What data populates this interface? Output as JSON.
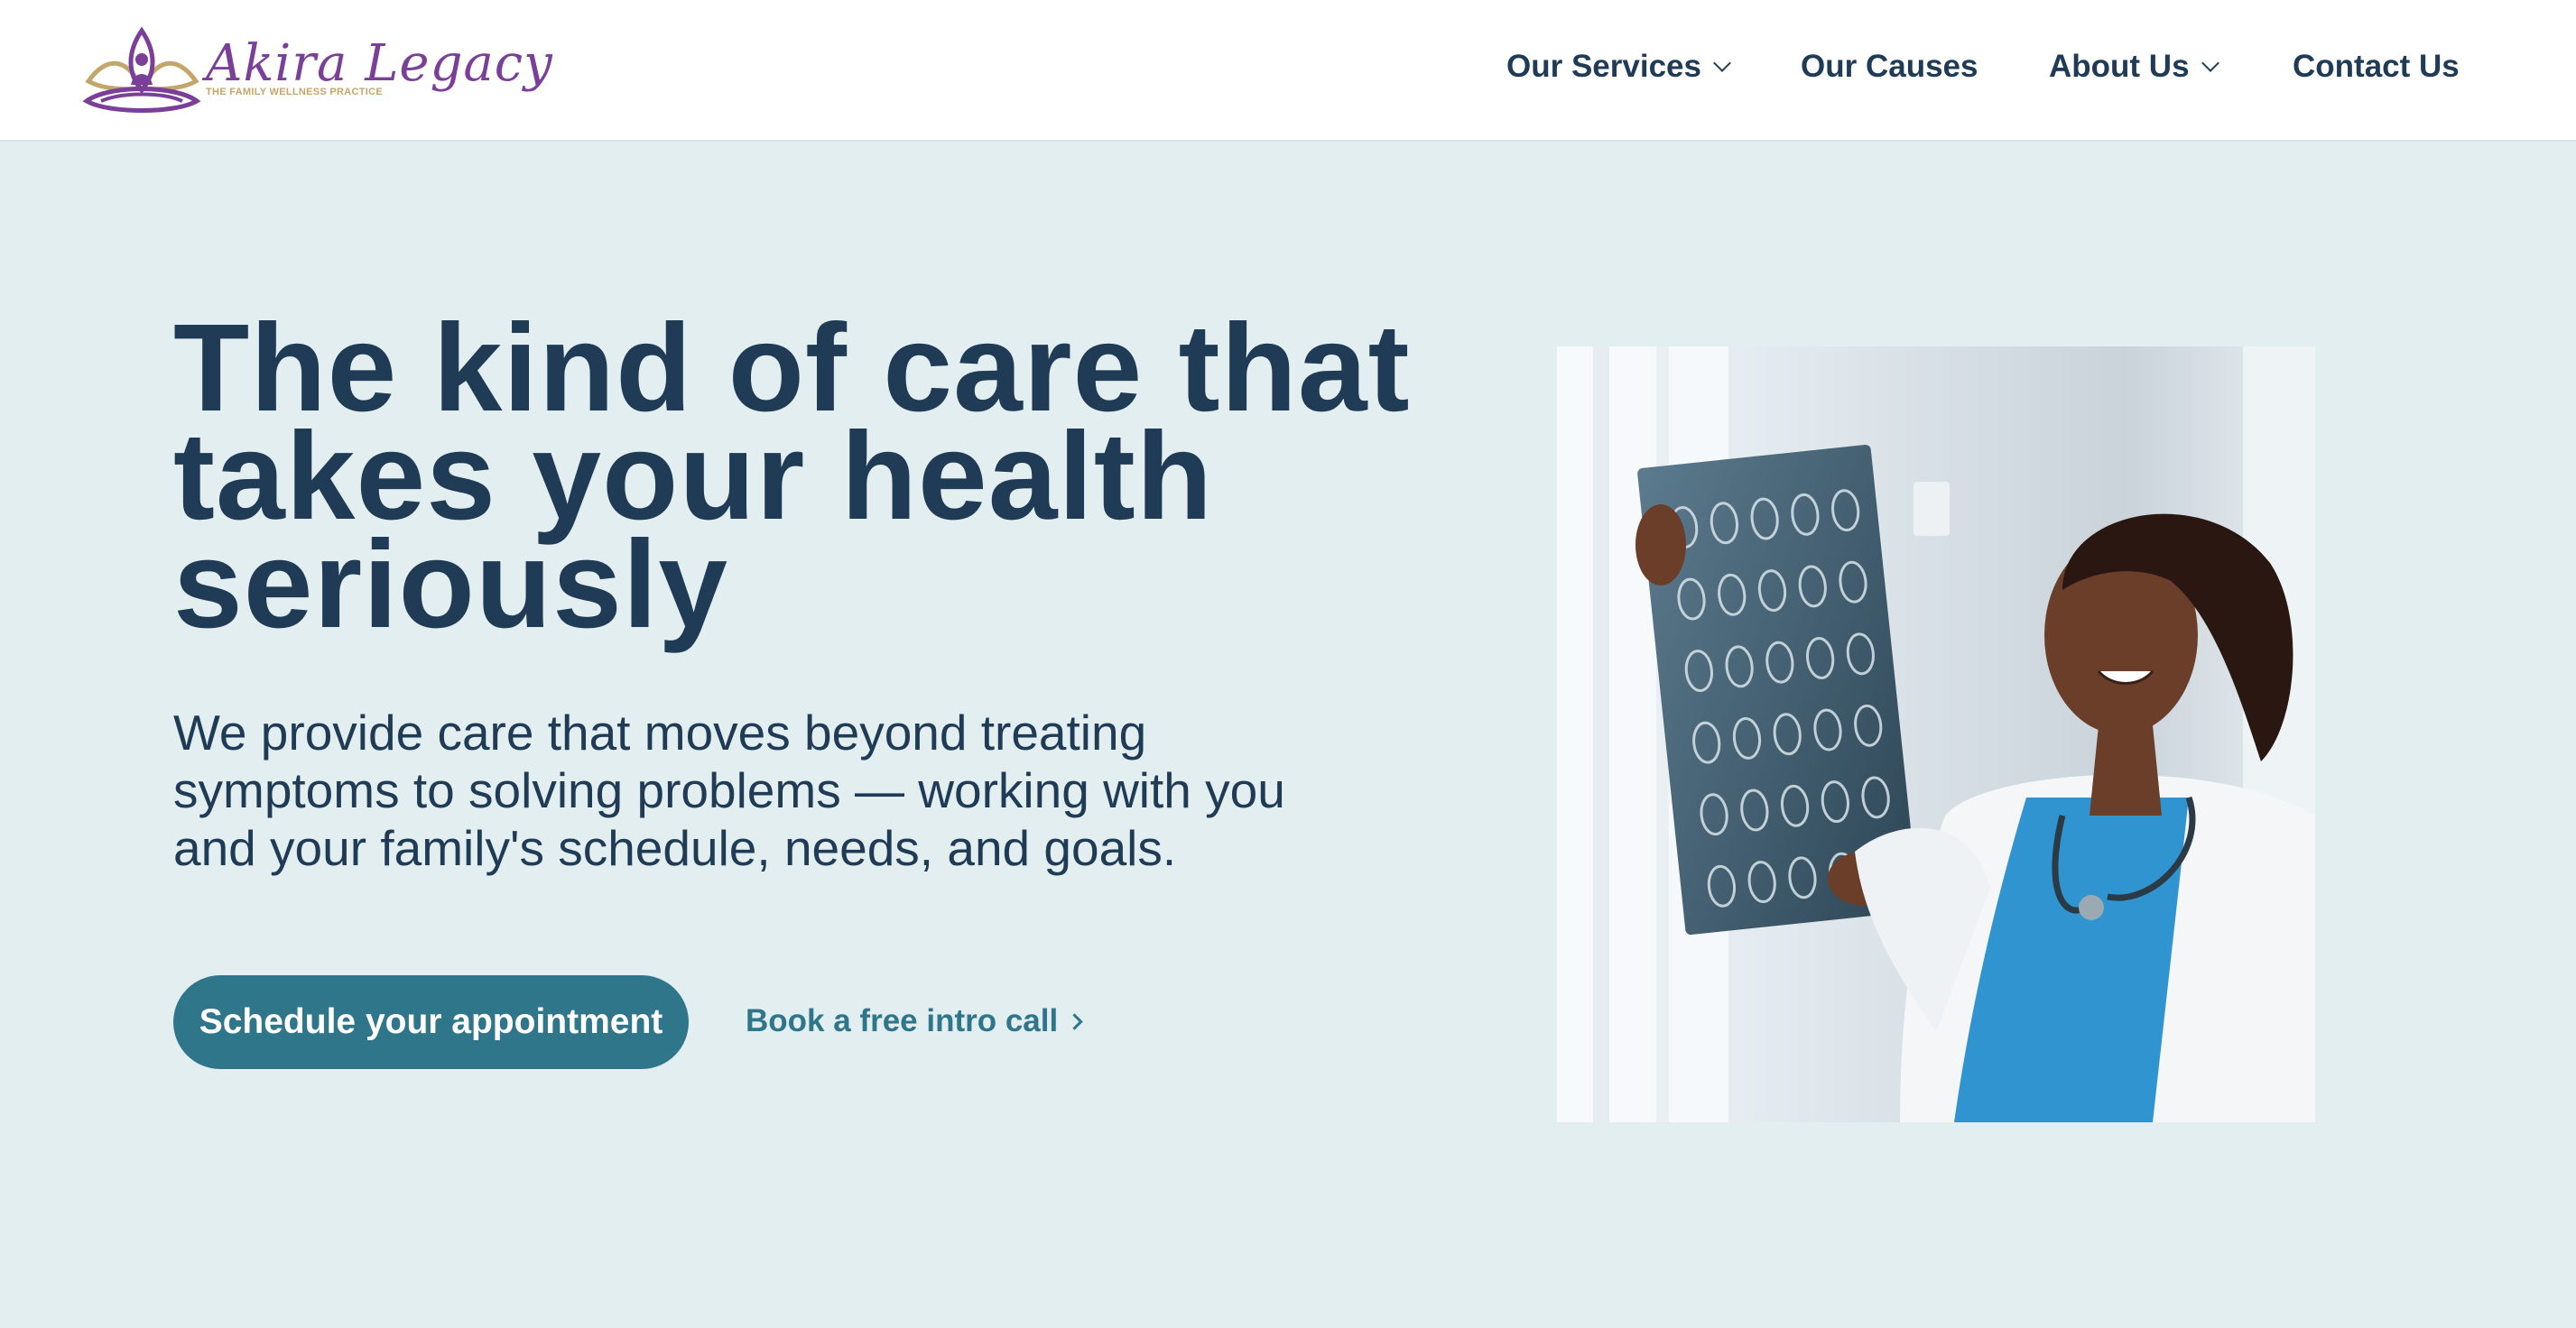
{
  "brand": {
    "name": "Akira Legacy",
    "tagline": "THE FAMILY WELLNESS PRACTICE",
    "primary_color": "#7a3f99",
    "accent_color": "#c2a66a"
  },
  "nav": {
    "items": [
      {
        "label": "Our Services",
        "has_dropdown": true
      },
      {
        "label": "Our Causes",
        "has_dropdown": false
      },
      {
        "label": "About Us",
        "has_dropdown": true
      },
      {
        "label": "Contact Us",
        "has_dropdown": false
      }
    ]
  },
  "hero": {
    "headline": "The kind of care that takes your health seriously",
    "subtext": "We provide care that moves beyond treating symptoms to solving problems — working with you and your family's schedule, needs, and goals.",
    "cta_primary": "Schedule your appointment",
    "cta_secondary": "Book a free intro call",
    "image_icon": "doctor-holding-xray-photo"
  },
  "colors": {
    "background": "#e3eef0",
    "text": "#1f3b55",
    "button": "#30768a"
  }
}
